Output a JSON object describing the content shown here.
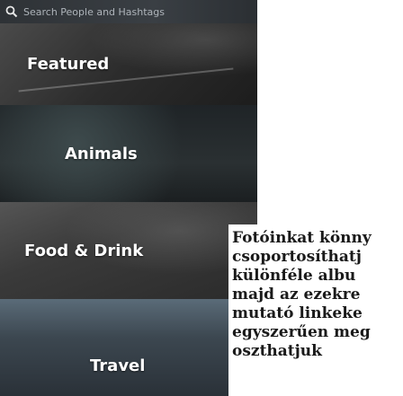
{
  "search": {
    "placeholder": "Search People and Hashtags"
  },
  "tiles": [
    {
      "label": "Featured"
    },
    {
      "label": "Animals"
    },
    {
      "label": "Food & Drink"
    },
    {
      "label": "Travel"
    }
  ],
  "panel": {
    "lines": [
      "Fotóinkat könny",
      "csoportosíthatj",
      "különféle albu",
      "majd az ezekre",
      "mutató linkeke",
      "egyszerűen meg",
      "oszthatjuk"
    ]
  }
}
